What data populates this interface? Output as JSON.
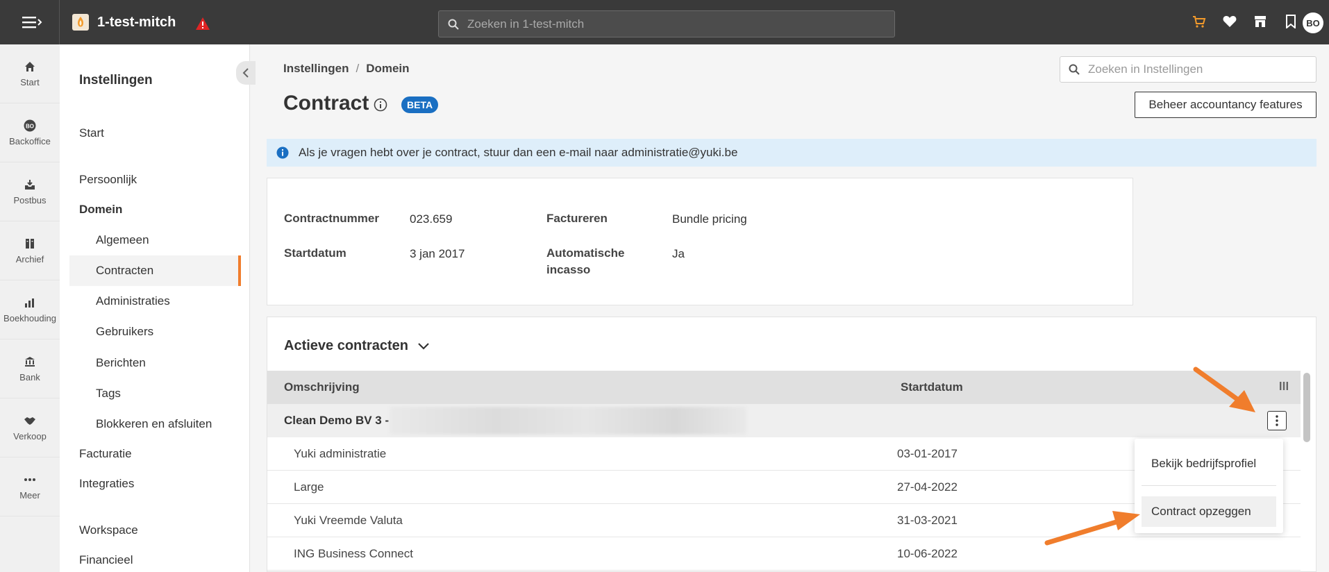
{
  "topbar": {
    "company_name": "1-test-mitch",
    "search_placeholder": "Zoeken in 1-test-mitch",
    "avatar_initials": "BO",
    "icons": [
      "menu-icon",
      "warning-icon",
      "cart-icon",
      "heart-icon",
      "store-icon",
      "bookmark-icon"
    ]
  },
  "rail": {
    "items": [
      {
        "label": "Start",
        "icon": "home-icon"
      },
      {
        "label": "Backoffice",
        "icon": "backoffice-icon",
        "badge": "BO"
      },
      {
        "label": "Postbus",
        "icon": "inbox-icon"
      },
      {
        "label": "Archief",
        "icon": "archive-icon"
      },
      {
        "label": "Boekhouding",
        "icon": "chart-icon"
      },
      {
        "label": "Bank",
        "icon": "bank-icon"
      },
      {
        "label": "Verkoop",
        "icon": "handshake-icon"
      },
      {
        "label": "Meer",
        "icon": "more-icon"
      }
    ]
  },
  "settings_nav": {
    "title": "Instellingen",
    "items": {
      "start": "Start",
      "persoonlijk": "Persoonlijk",
      "domein": "Domein",
      "algemeen": "Algemeen",
      "contracten": "Contracten",
      "administraties": "Administraties",
      "gebruikers": "Gebruikers",
      "berichten": "Berichten",
      "tags": "Tags",
      "blokkeren": "Blokkeren en afsluiten",
      "facturatie": "Facturatie",
      "integraties": "Integraties",
      "workspace": "Workspace",
      "financieel": "Financieel"
    }
  },
  "main": {
    "breadcrumb": {
      "root": "Instellingen",
      "sep": "/",
      "current": "Domein"
    },
    "search_placeholder": "Zoeken in Instellingen",
    "title": "Contract",
    "beta": "BETA",
    "features_button": "Beheer accountancy features",
    "banner": "Als je vragen hebt over je contract, stuur dan een e-mail naar administratie@yuki.be",
    "details": {
      "contractnummer_label": "Contractnummer",
      "contractnummer": "023.659",
      "factureren_label": "Factureren",
      "factureren": "Bundle pricing",
      "startdatum_label": "Startdatum",
      "startdatum": "3 jan 2017",
      "incasso_label_1": "Automatische",
      "incasso_label_2": "incasso",
      "incasso": "Ja"
    },
    "contracts": {
      "section_title": "Actieve contracten",
      "columns": {
        "description": "Omschrijving",
        "start": "Startdatum"
      },
      "group": "Clean Demo BV 3 -",
      "rows": [
        {
          "name": "Yuki administratie",
          "date": "03-01-2017"
        },
        {
          "name": "Large",
          "date": "27-04-2022"
        },
        {
          "name": "Yuki Vreemde Valuta",
          "date": "31-03-2021"
        },
        {
          "name": "ING Business Connect",
          "date": "10-06-2022"
        }
      ]
    },
    "menu": {
      "view_profile": "Bekijk bedrijfsprofiel",
      "cancel_contract": "Contract opzeggen"
    }
  },
  "colors": {
    "topbar": "#3a3a3a",
    "accent": "#f07d2c",
    "beta": "#1a6fc2",
    "banner": "#deeefa"
  }
}
